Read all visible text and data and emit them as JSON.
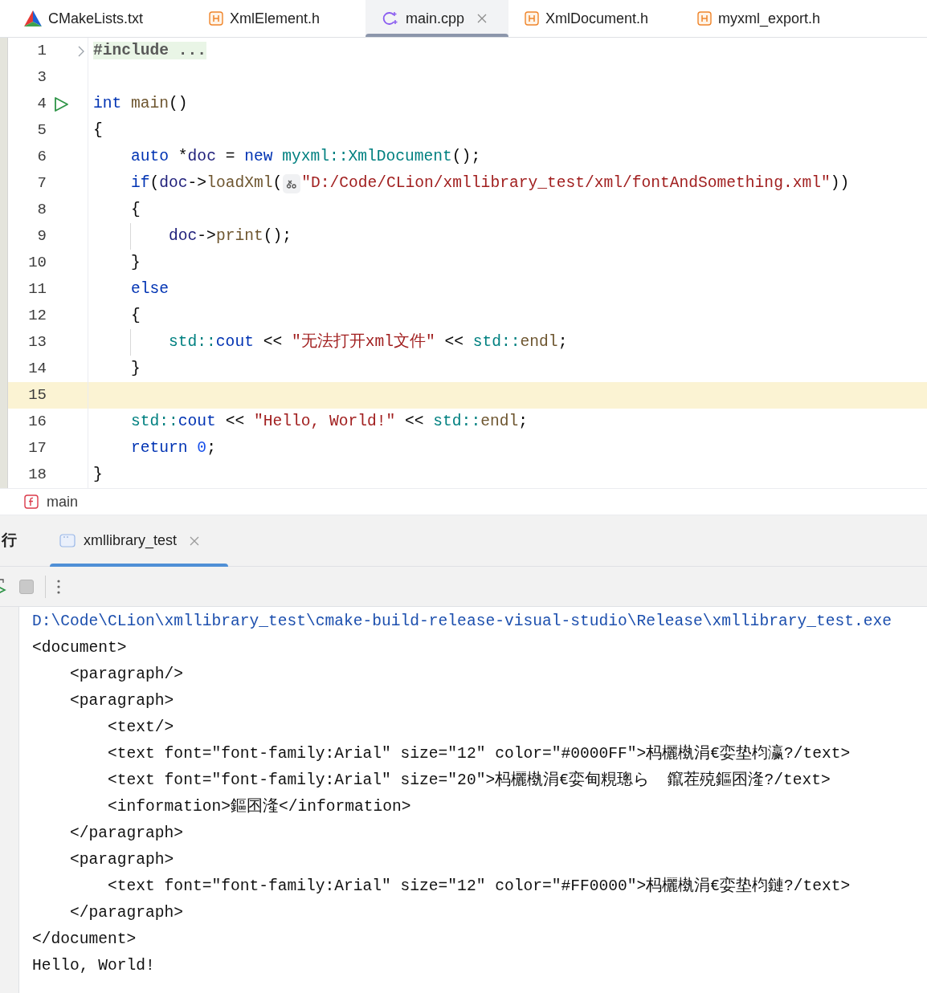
{
  "tabs": [
    {
      "label": "CMakeLists.txt",
      "kind": "cmake",
      "selected": false
    },
    {
      "label": "XmlElement.h",
      "kind": "header",
      "selected": false
    },
    {
      "label": "main.cpp",
      "kind": "cpp",
      "selected": true
    },
    {
      "label": "XmlDocument.h",
      "kind": "header",
      "selected": false
    },
    {
      "label": "myxml_export.h",
      "kind": "header",
      "selected": false
    }
  ],
  "editor": {
    "lines": [
      {
        "number": "1",
        "foldable": true,
        "current": false,
        "tokens": [
          {
            "kind": "folded",
            "text": "#include ..."
          }
        ]
      },
      {
        "number": "3",
        "current": false
      },
      {
        "number": "4",
        "runnable": true,
        "current": false,
        "tokens": [
          {
            "kind": "kw",
            "text": "int"
          },
          {
            "kind": "fn",
            "text": " main"
          },
          {
            "kind": "plain",
            "text": "()"
          }
        ]
      },
      {
        "number": "5",
        "current": false,
        "tokens": [
          {
            "kind": "plain",
            "text": "{"
          }
        ]
      },
      {
        "number": "6",
        "current": false,
        "tokens": [
          {
            "kind": "kw",
            "text": "    auto"
          },
          {
            "kind": "plain",
            "text": " *"
          },
          {
            "kind": "var",
            "text": "doc"
          },
          {
            "kind": "plain",
            "text": " = "
          },
          {
            "kind": "kw",
            "text": "new"
          },
          {
            "kind": "ns",
            "text": " myxml::XmlDocument"
          },
          {
            "kind": "plain",
            "text": "();"
          }
        ]
      },
      {
        "number": "7",
        "current": false,
        "tokens": [
          {
            "kind": "kw",
            "text": "    if"
          },
          {
            "kind": "plain",
            "text": "("
          },
          {
            "kind": "var",
            "text": "doc"
          },
          {
            "kind": "plain",
            "text": "->"
          },
          {
            "kind": "fn",
            "text": "loadXml"
          },
          {
            "kind": "plain",
            "text": "("
          },
          {
            "kind": "inlay"
          },
          {
            "kind": "str",
            "text": "\"D:/Code/CLion/xmllibrary_test/xml/fontAndSomething.xml\""
          },
          {
            "kind": "plain",
            "text": "))"
          }
        ]
      },
      {
        "number": "8",
        "current": false,
        "tokens": [
          {
            "kind": "plain",
            "text": "    {"
          }
        ]
      },
      {
        "number": "9",
        "current": false,
        "guide": true,
        "tokens": [
          {
            "kind": "var",
            "text": "        doc"
          },
          {
            "kind": "plain",
            "text": "->"
          },
          {
            "kind": "fn",
            "text": "print"
          },
          {
            "kind": "plain",
            "text": "();"
          }
        ]
      },
      {
        "number": "10",
        "current": false,
        "tokens": [
          {
            "kind": "plain",
            "text": "    }"
          }
        ]
      },
      {
        "number": "11",
        "current": false,
        "tokens": [
          {
            "kind": "kw",
            "text": "    else"
          }
        ]
      },
      {
        "number": "12",
        "current": false,
        "tokens": [
          {
            "kind": "plain",
            "text": "    {"
          }
        ]
      },
      {
        "number": "13",
        "current": false,
        "guide": true,
        "tokens": [
          {
            "kind": "ns",
            "text": "        std::"
          },
          {
            "kind": "kw",
            "text": "cout"
          },
          {
            "kind": "plain",
            "text": " << "
          },
          {
            "kind": "str",
            "text": "\"无法打开xml文件\""
          },
          {
            "kind": "plain",
            "text": " << "
          },
          {
            "kind": "ns",
            "text": "std::"
          },
          {
            "kind": "fn",
            "text": "endl"
          },
          {
            "kind": "plain",
            "text": ";"
          }
        ]
      },
      {
        "number": "14",
        "current": false,
        "tokens": [
          {
            "kind": "plain",
            "text": "    }"
          }
        ]
      },
      {
        "number": "15",
        "current": true
      },
      {
        "number": "16",
        "current": false,
        "tokens": [
          {
            "kind": "ns",
            "text": "    std::"
          },
          {
            "kind": "kw",
            "text": "cout"
          },
          {
            "kind": "plain",
            "text": " << "
          },
          {
            "kind": "str",
            "text": "\"Hello, World!\""
          },
          {
            "kind": "plain",
            "text": " << "
          },
          {
            "kind": "ns",
            "text": "std::"
          },
          {
            "kind": "fn",
            "text": "endl"
          },
          {
            "kind": "plain",
            "text": ";"
          }
        ]
      },
      {
        "number": "17",
        "current": false,
        "tokens": [
          {
            "kind": "kw",
            "text": "    return"
          },
          {
            "kind": "num",
            "text": " 0"
          },
          {
            "kind": "plain",
            "text": ";"
          }
        ]
      },
      {
        "number": "18",
        "current": false,
        "tokens": [
          {
            "kind": "plain",
            "text": "}"
          }
        ]
      }
    ]
  },
  "breadcrumb": {
    "label": "main"
  },
  "run_panel": {
    "title": "行",
    "tabs": [
      {
        "label": "xmllibrary_test",
        "selected": true
      }
    ],
    "console": [
      {
        "kind": "command",
        "text": "D:\\Code\\CLion\\xmllibrary_test\\cmake-build-release-visual-studio\\Release\\xmllibrary_test.exe"
      },
      {
        "kind": "output",
        "text": "<document>"
      },
      {
        "kind": "output",
        "text": "    <paragraph/>"
      },
      {
        "kind": "output",
        "text": "    <paragraph>"
      },
      {
        "kind": "output",
        "text": "        <text/>"
      },
      {
        "kind": "output",
        "text": "        <text font=\"font-family:Arial\" size=\"12\" color=\"#0000FF\">杩欐槸涓€娈垫枃瀛?/text>"
      },
      {
        "kind": "output",
        "text": "        <text font=\"font-family:Arial\" size=\"20\">杩欐槸涓€娈甸粯璁ら  鑹茬殑鏂囨湰?/text>"
      },
      {
        "kind": "output",
        "text": "        <information>鏂囨湰</information>"
      },
      {
        "kind": "output",
        "text": "    </paragraph>"
      },
      {
        "kind": "output",
        "text": "    <paragraph>"
      },
      {
        "kind": "output",
        "text": "        <text font=\"font-family:Arial\" size=\"12\" color=\"#FF0000\">杩欐槸涓€娈垫枃鏈?/text>"
      },
      {
        "kind": "output",
        "text": "    </paragraph>"
      },
      {
        "kind": "output",
        "text": "</document>"
      },
      {
        "kind": "output",
        "text": "Hello, World!"
      }
    ]
  }
}
